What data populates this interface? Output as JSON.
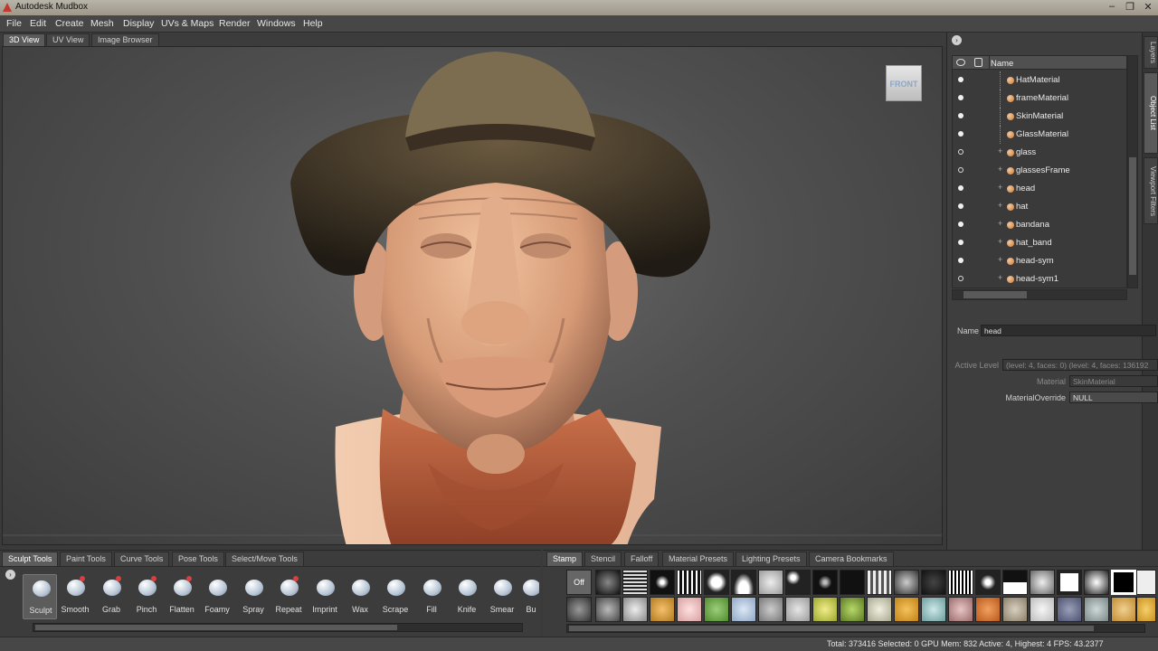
{
  "titlebar": {
    "title": "Autodesk Mudbox",
    "min": "–",
    "max": "❐",
    "close": "✕"
  },
  "menu": [
    "File",
    "Edit",
    "Create",
    "Mesh",
    "Display",
    "UVs & Maps",
    "Render",
    "Windows",
    "Help"
  ],
  "view_tabs": [
    "3D View",
    "UV View",
    "Image Browser"
  ],
  "viewcube_label": "FRONT",
  "side_tabs": [
    "Layers",
    "Object List",
    "Viewport Filters"
  ],
  "object_list": {
    "header": "Name",
    "rows": [
      {
        "label": "HatMaterial",
        "visible": true,
        "kind": "material"
      },
      {
        "label": "frameMaterial",
        "visible": true,
        "kind": "material"
      },
      {
        "label": "SkinMaterial",
        "visible": true,
        "kind": "material"
      },
      {
        "label": "GlassMaterial",
        "visible": true,
        "kind": "material"
      },
      {
        "label": "glass",
        "visible": false,
        "kind": "mesh"
      },
      {
        "label": "glassesFrame",
        "visible": false,
        "kind": "mesh"
      },
      {
        "label": "head",
        "visible": true,
        "kind": "mesh"
      },
      {
        "label": "hat",
        "visible": true,
        "kind": "mesh"
      },
      {
        "label": "bandana",
        "visible": true,
        "kind": "mesh"
      },
      {
        "label": "hat_band",
        "visible": true,
        "kind": "mesh"
      },
      {
        "label": "head-sym",
        "visible": true,
        "kind": "mesh"
      },
      {
        "label": "head-sym1",
        "visible": false,
        "kind": "mesh"
      }
    ]
  },
  "properties": {
    "name_label": "Name",
    "name_value": "head",
    "active_level_label": "Active Level",
    "active_level_value": "(level: 4, faces: 0) (level: 4, faces: 136192",
    "material_label": "Material",
    "material_value": "SkinMaterial",
    "override_label": "MaterialOverride",
    "override_value": "NULL"
  },
  "tool_tabs": [
    "Sculpt Tools",
    "Paint Tools",
    "Curve Tools",
    "Pose Tools",
    "Select/Move Tools"
  ],
  "sculpt_tools": [
    "Sculpt",
    "Smooth",
    "Grab",
    "Pinch",
    "Flatten",
    "Foamy",
    "Spray",
    "Repeat",
    "Imprint",
    "Wax",
    "Scrape",
    "Fill",
    "Knife",
    "Smear",
    "Bu"
  ],
  "tray_tabs": [
    "Stamp",
    "Stencil",
    "Falloff",
    "Material Presets",
    "Lighting Presets",
    "Camera Bookmarks"
  ],
  "stamp_off_label": "Off",
  "status": "Total: 373416  Selected: 0 GPU Mem: 832  Active: 4, Highest: 4  FPS: 43.2377",
  "colors": {
    "accent": "#c0392b",
    "skin": "#e1a884",
    "bandana": "#b2583a",
    "hat": "#3a3226"
  }
}
